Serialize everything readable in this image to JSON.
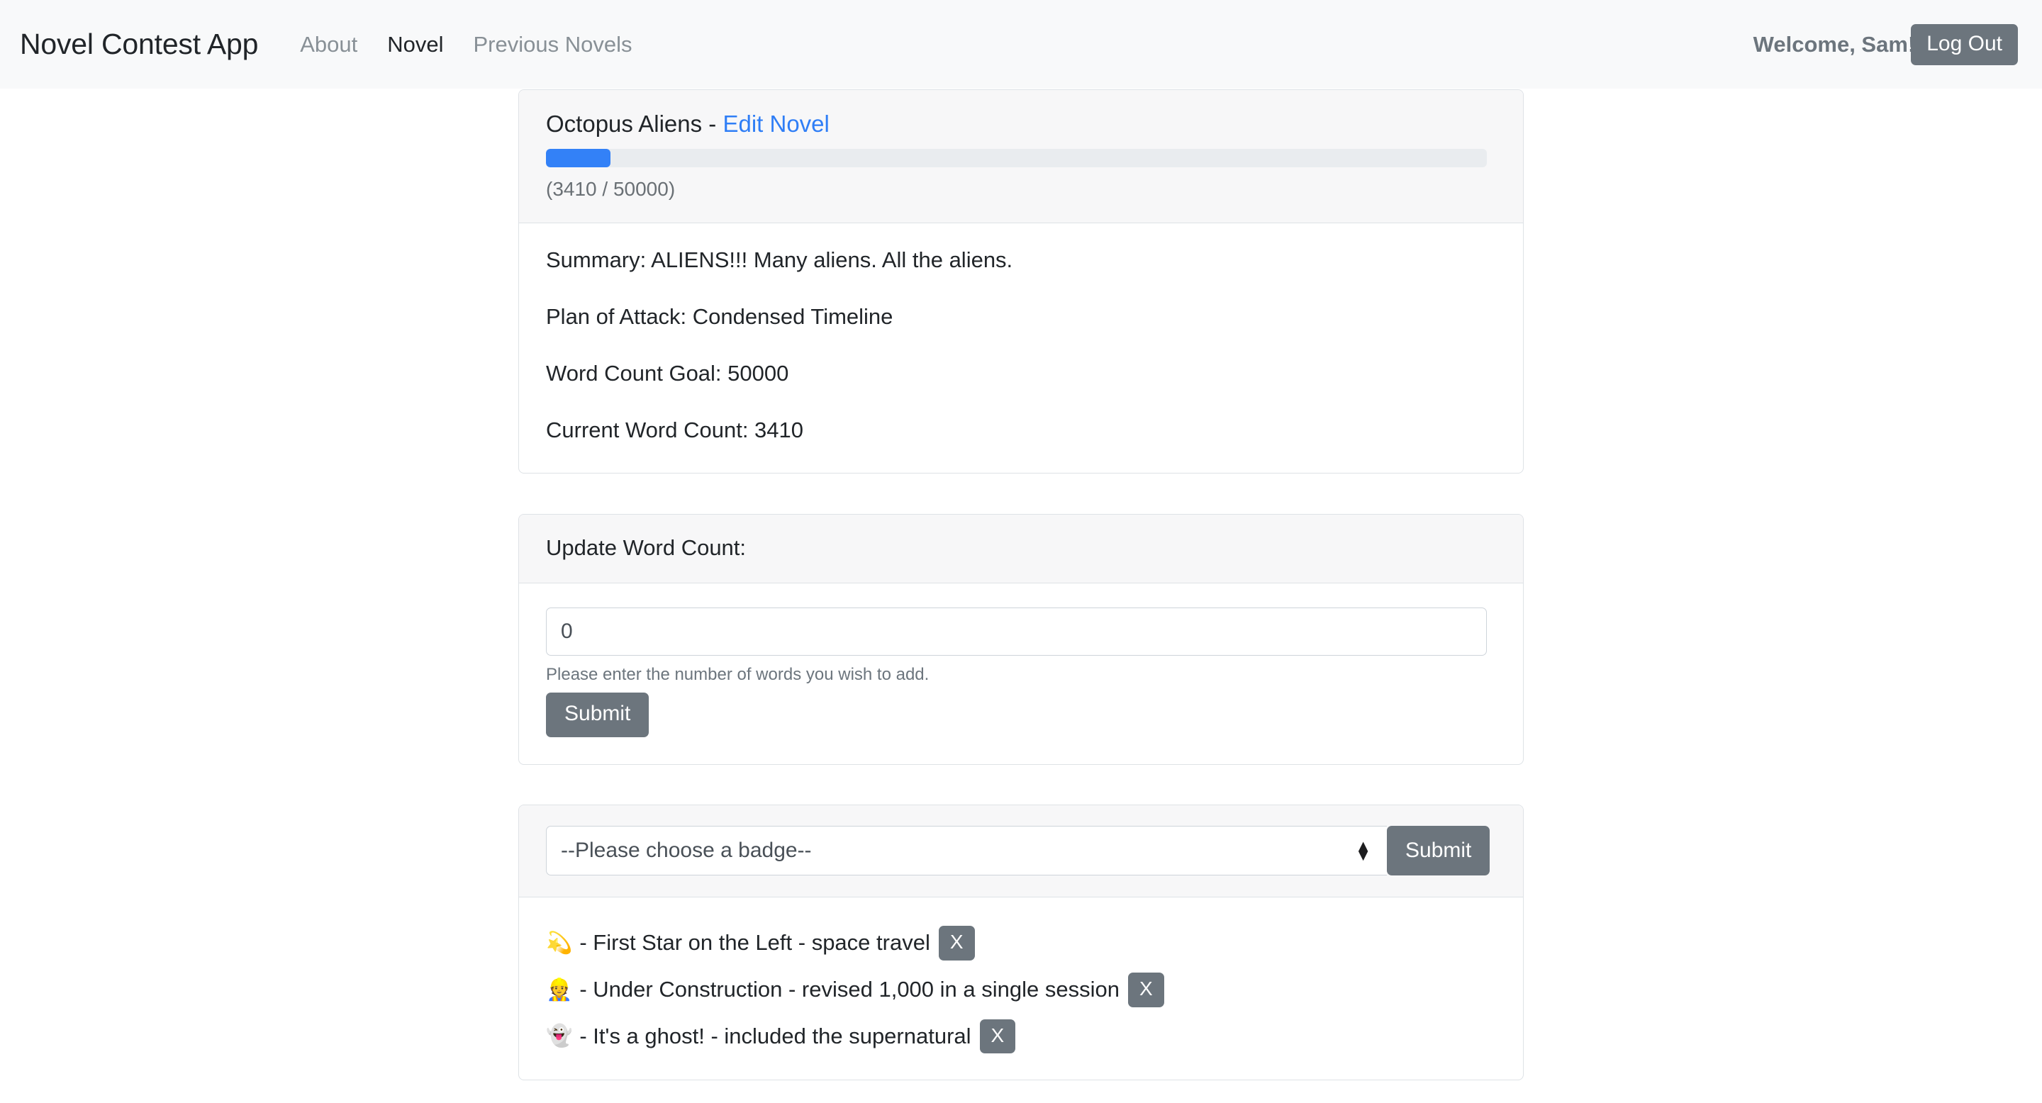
{
  "navbar": {
    "brand": "Novel Contest App",
    "links": [
      {
        "label": "About",
        "active": false
      },
      {
        "label": "Novel",
        "active": true
      },
      {
        "label": "Previous Novels",
        "active": false
      }
    ],
    "welcome": "Welcome, Sam!",
    "logout_label": "Log Out"
  },
  "novel": {
    "title": "Octopus Aliens",
    "title_separator": " - ",
    "edit_link": "Edit Novel",
    "progress": {
      "current": 3410,
      "goal": 50000,
      "percent": 6.82,
      "label": "(3410 / 50000)",
      "fill_color": "#3381f7",
      "track_color": "#e9ecef"
    },
    "details": [
      "Summary: ALIENS!!! Many aliens. All the aliens.",
      "Plan of Attack: Condensed Timeline",
      "Word Count Goal: 50000",
      "Current Word Count: 3410"
    ]
  },
  "update_word_count": {
    "header": "Update Word Count:",
    "input_value": "0",
    "input_placeholder": "0",
    "help_text": "Please enter the number of words you wish to add.",
    "submit_label": "Submit"
  },
  "badges": {
    "select_value": "--Please choose a badge--",
    "submit_label": "Submit",
    "remove_label": "X",
    "earned": [
      {
        "emoji": "💫",
        "icon_name": "shooting-star-badge-icon",
        "text": "- First Star on the Left - space travel"
      },
      {
        "emoji": "👷",
        "icon_name": "construction-worker-badge-icon",
        "text": "- Under Construction - revised 1,000 in a single session"
      },
      {
        "emoji": "👻",
        "icon_name": "ghost-badge-icon",
        "text": "- It's a ghost! - included the supernatural"
      }
    ]
  },
  "theme": {
    "navbar_bg": "#f8f9fa",
    "button_gray": "#6c757d",
    "link_blue": "#2f7ef6",
    "card_header_bg": "#f7f7f8",
    "border": "#dee2e6"
  }
}
